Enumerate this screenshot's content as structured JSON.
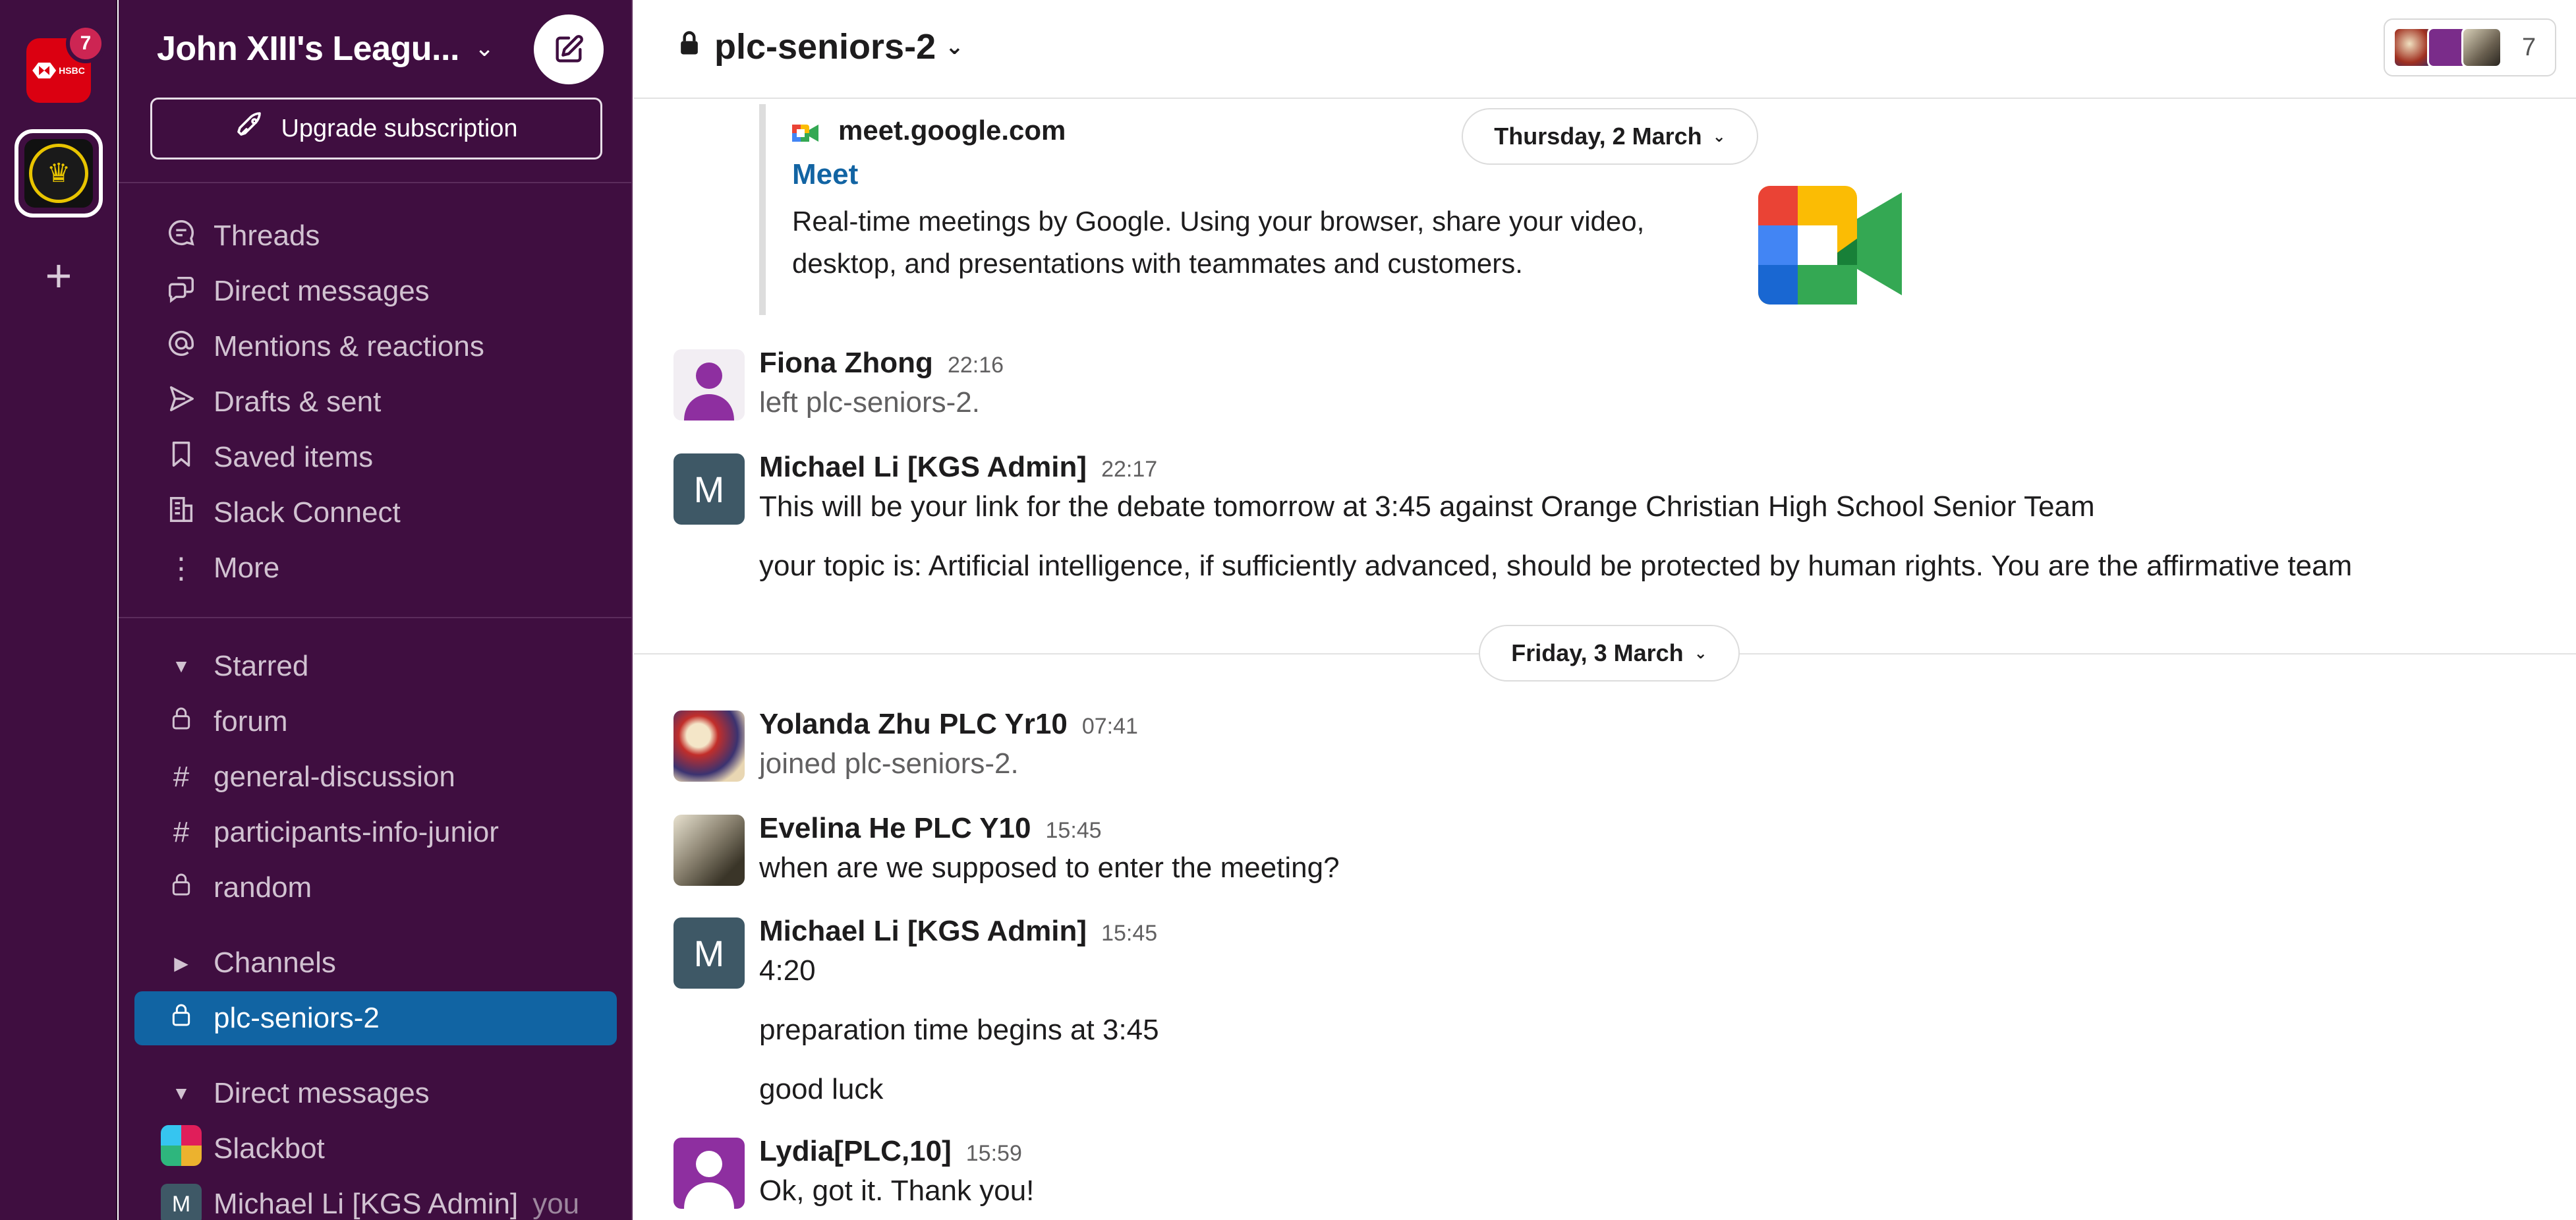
{
  "rail": {
    "hsbc_label": "HSBC",
    "hsbc_badge": "7"
  },
  "sidebar": {
    "workspace_name": "John XIII's Leagu...",
    "upgrade_label": "Upgrade subscription",
    "nav": [
      {
        "label": "Threads",
        "icon": "threads-icon"
      },
      {
        "label": "Direct messages",
        "icon": "direct-messages-icon"
      },
      {
        "label": "Mentions & reactions",
        "icon": "at-icon"
      },
      {
        "label": "Drafts & sent",
        "icon": "send-icon"
      },
      {
        "label": "Saved items",
        "icon": "bookmark-icon"
      },
      {
        "label": "Slack Connect",
        "icon": "building-icon"
      },
      {
        "label": "More",
        "icon": "more-vertical-icon"
      }
    ],
    "starred_label": "Starred",
    "starred": [
      {
        "label": "forum",
        "type": "private"
      },
      {
        "label": "general-discussion",
        "type": "public"
      },
      {
        "label": "participants-info-junior",
        "type": "public"
      },
      {
        "label": "random",
        "type": "private"
      }
    ],
    "channels_label": "Channels",
    "active_channel": "plc-seniors-2",
    "dm_label": "Direct messages",
    "dms": [
      {
        "label": "Slackbot"
      },
      {
        "label": "Michael Li [KGS Admin]",
        "suffix": "you"
      }
    ]
  },
  "header": {
    "channel": "plc-seniors-2",
    "member_count": "7"
  },
  "messages": {
    "unfurl": {
      "site": "meet.google.com",
      "title": "Meet",
      "description": "Real-time meetings by Google. Using your browser, share your video, desktop, and presentations with teammates and customers."
    },
    "date1": "Thursday, 2 March",
    "date2": "Friday, 3 March",
    "items": [
      {
        "name": "Fiona Zhong",
        "time": "22:16",
        "lines": [
          "left plc-seniors-2."
        ]
      },
      {
        "name": "Michael Li [KGS Admin]",
        "time": "22:17",
        "avatar_letter": "M",
        "lines": [
          "This will be your link for the debate tomorrow at 3:45 against Orange Christian High School Senior Team",
          "your topic is: Artificial intelligence, if sufficiently advanced, should be protected by human rights. You are the affirmative team"
        ]
      },
      {
        "name": "Yolanda Zhu PLC Yr10",
        "time": "07:41",
        "lines": [
          "joined plc-seniors-2."
        ]
      },
      {
        "name": "Evelina He PLC Y10",
        "time": "15:45",
        "lines": [
          "when are we supposed to enter the meeting?"
        ]
      },
      {
        "name": "Michael Li [KGS Admin]",
        "time": "15:45",
        "avatar_letter": "M",
        "lines": [
          "4:20",
          "preparation time begins at 3:45",
          "good luck"
        ]
      },
      {
        "name": "Lydia[PLC,10]",
        "time": "15:59",
        "lines": [
          "Ok, got it. Thank you!"
        ]
      }
    ]
  },
  "colors": {
    "sidebar_bg": "#3f0e40",
    "active_item": "#1164a3",
    "link": "#1264a3"
  }
}
